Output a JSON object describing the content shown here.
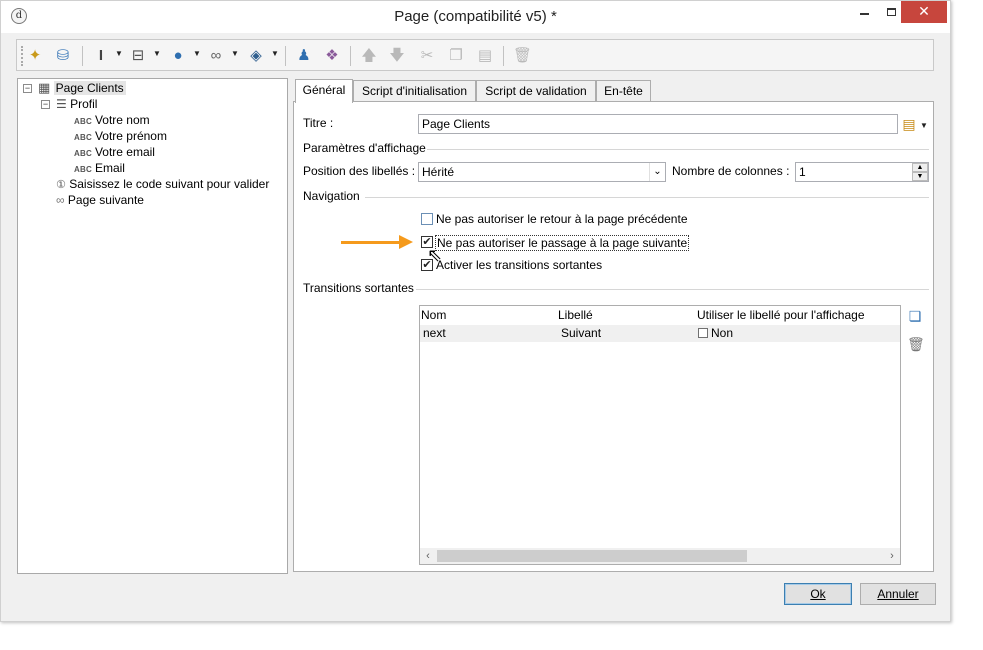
{
  "window": {
    "title": "Page (compatibilité v5) *",
    "close_glyph": "✕"
  },
  "toolbar": {
    "icons": [
      "magic-wand-icon",
      "database-icon",
      "text-cursor-icon",
      "flow-icon",
      "globe-icon",
      "link-icon",
      "layers-icon",
      "user-icon",
      "add-node-icon",
      "arrow-up-icon",
      "arrow-down-icon",
      "cut-icon",
      "copy-icon",
      "paste-icon",
      "delete-icon"
    ]
  },
  "tree": {
    "root": "Page Clients",
    "profil": "Profil",
    "abc_tag": "ABC",
    "fields": [
      "Votre nom",
      "Votre prénom",
      "Votre email",
      "Email"
    ],
    "validation": "Saisissez le code suivant pour valider",
    "next_page": "Page suivante"
  },
  "tabs": [
    "Général",
    "Script d'initialisation",
    "Script de validation",
    "En-tête"
  ],
  "form": {
    "titre_label": "Titre :",
    "titre_value": "Page Clients",
    "display_section": "Paramètres d'affichage",
    "position_label": "Position des libellés :",
    "position_value": "Hérité",
    "columns_label": "Nombre de colonnes :",
    "columns_value": "1",
    "navigation_section": "Navigation",
    "nav_options": [
      {
        "label": "Ne pas autoriser le retour à la page précédente",
        "checked": false
      },
      {
        "label": "Ne pas autoriser le passage à la page suivante",
        "checked": true
      },
      {
        "label": "Activer les transitions sortantes",
        "checked": true
      }
    ],
    "transitions_section": "Transitions sortantes"
  },
  "grid": {
    "columns": [
      "Nom",
      "Libellé",
      "Utiliser le libellé pour l'affichage"
    ],
    "rows": [
      {
        "nom": "next",
        "libelle": "Suivant",
        "use_label": "Non"
      }
    ]
  },
  "buttons": {
    "ok": "Ok",
    "cancel": "Annuler"
  },
  "colors": {
    "annotation_arrow": "#f59a1c",
    "close_button": "#c7463d"
  }
}
